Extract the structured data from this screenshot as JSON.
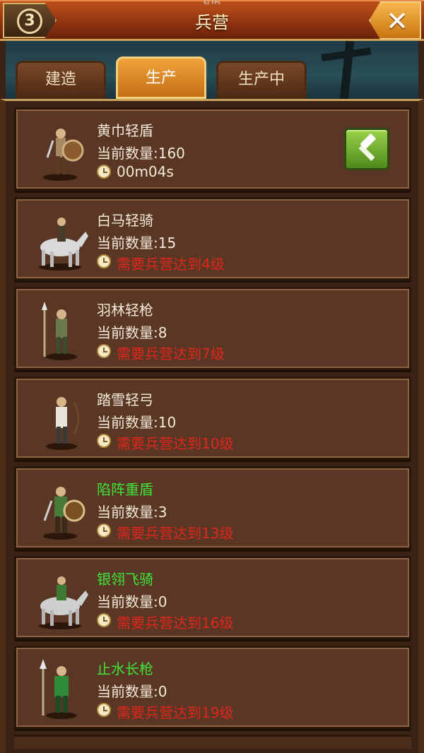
{
  "fps": "62 FPS",
  "header": {
    "title": "兵营",
    "level": "3",
    "close": "✕"
  },
  "tabs": [
    {
      "label": "建造",
      "active": false
    },
    {
      "label": "生产",
      "active": true
    },
    {
      "label": "生产中",
      "active": false
    }
  ],
  "units": [
    {
      "name": "黄巾轻盾",
      "count": "当前数量:160",
      "status": "00m04s",
      "rare": false,
      "ready": true
    },
    {
      "name": "白马轻骑",
      "count": "当前数量:15",
      "status": "需要兵营达到4级",
      "rare": false,
      "ready": false
    },
    {
      "name": "羽林轻枪",
      "count": "当前数量:8",
      "status": "需要兵营达到7级",
      "rare": false,
      "ready": false
    },
    {
      "name": "踏雪轻弓",
      "count": "当前数量:10",
      "status": "需要兵营达到10级",
      "rare": false,
      "ready": false
    },
    {
      "name": "陷阵重盾",
      "count": "当前数量:3",
      "status": "需要兵营达到13级",
      "rare": true,
      "ready": false
    },
    {
      "name": "银翎飞骑",
      "count": "当前数量:0",
      "status": "需要兵营达到16级",
      "rare": true,
      "ready": false
    },
    {
      "name": "止水长枪",
      "count": "当前数量:0",
      "status": "需要兵营达到19级",
      "rare": true,
      "ready": false
    }
  ]
}
